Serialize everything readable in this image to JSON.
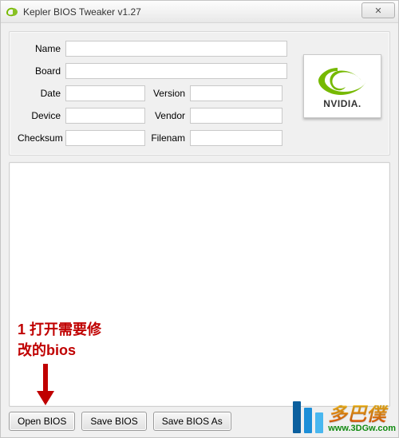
{
  "window": {
    "title": "Kepler BIOS Tweaker v1.27",
    "close_glyph": "✕"
  },
  "info": {
    "labels": {
      "name": "Name",
      "board": "Board",
      "date": "Date",
      "device": "Device",
      "checksum": "Checksum",
      "version": "Version",
      "vendor": "Vendor",
      "filenam": "Filenam"
    },
    "values": {
      "name": "",
      "board": "",
      "date": "",
      "device": "",
      "checksum": "",
      "version": "",
      "vendor": "",
      "filenam": ""
    }
  },
  "logo": {
    "brand": "NVIDIA"
  },
  "annotation": {
    "line1": "1 打开需要修",
    "line2": "改的bios"
  },
  "buttons": {
    "open": "Open BIOS",
    "save": "Save BIOS",
    "save_as": "Save BIOS As"
  },
  "watermark": {
    "brand_cn": "多巴僕",
    "url": "www.3DGw.com"
  }
}
